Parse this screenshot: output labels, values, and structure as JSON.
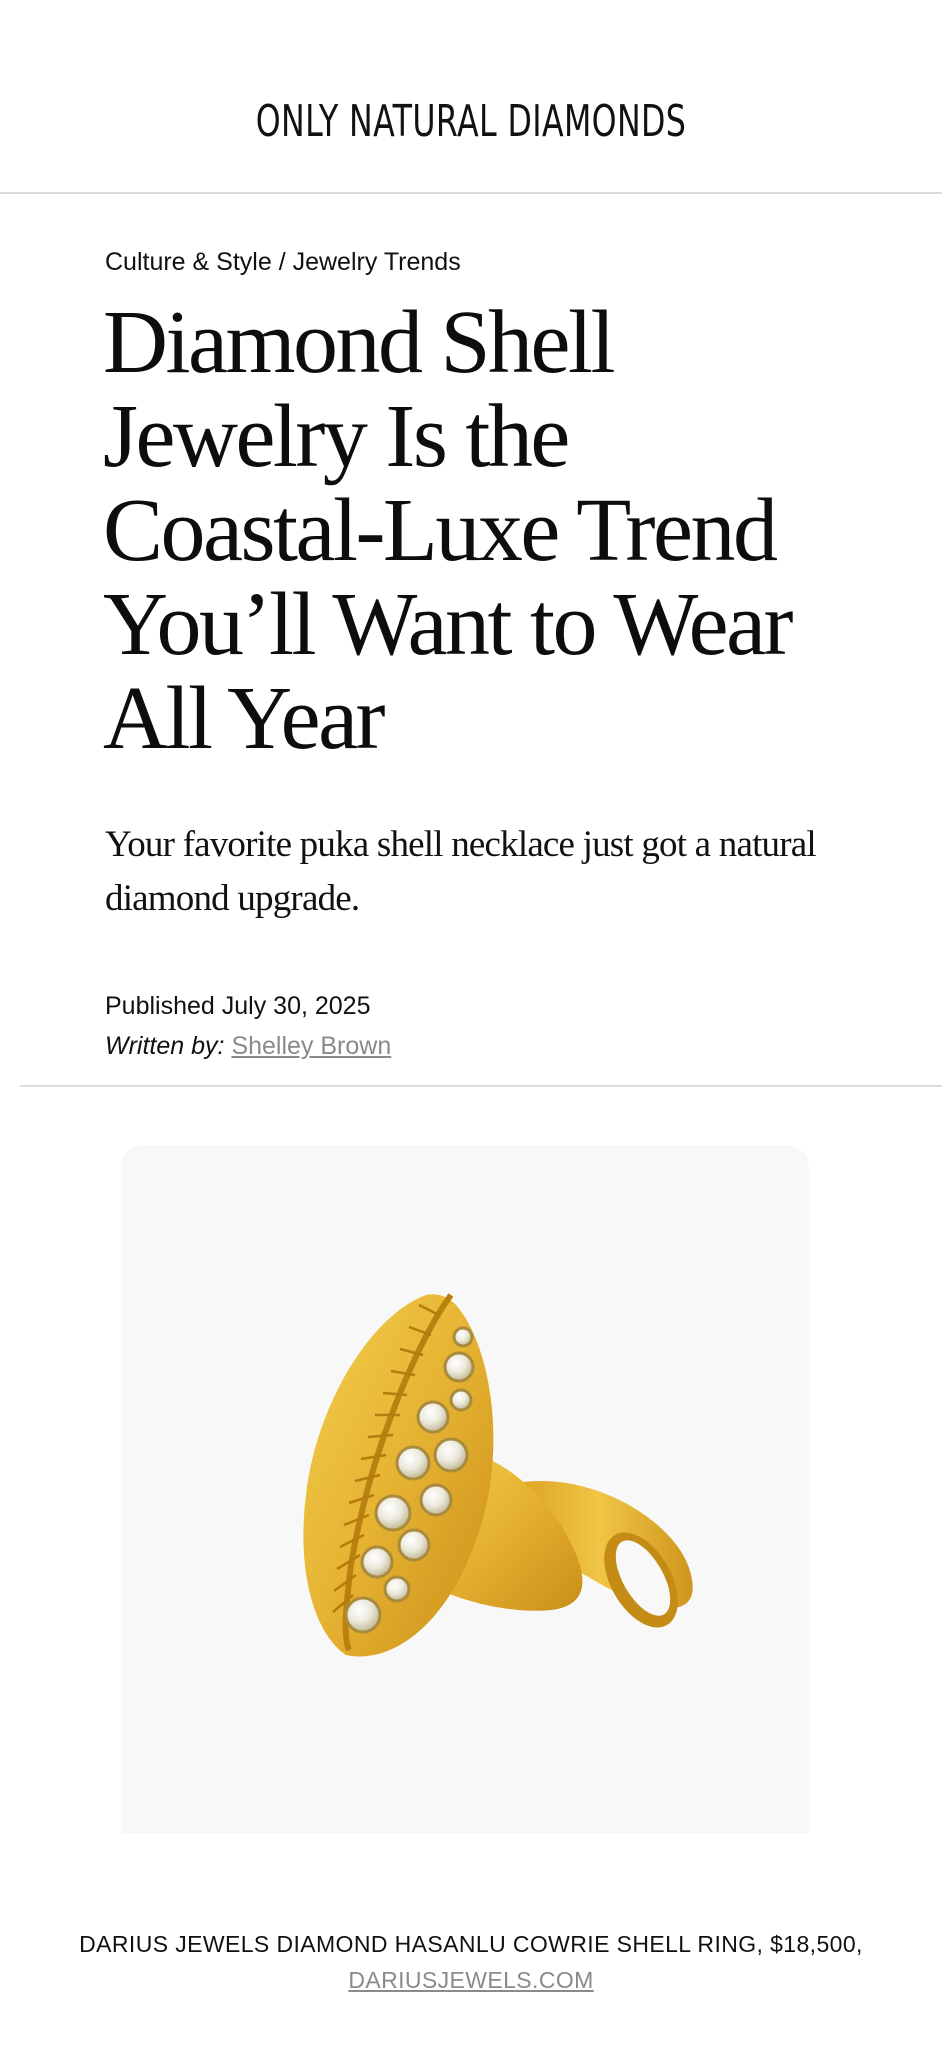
{
  "site": {
    "logo": "ONLY NATURAL DIAMONDS"
  },
  "breadcrumb": {
    "section": "Culture & Style",
    "separator": " / ",
    "category": "Jewelry Trends"
  },
  "article": {
    "title": "Diamond Shell Jewelry Is the Coastal-Luxe Trend You’ll Want to Wear All Year",
    "subtitle": "Your favorite puka shell necklace just got a natural diamond upgrade.",
    "published_label": "Published",
    "published_date": "July 30, 2025",
    "written_by_label": "Written by:",
    "author": "Shelley Brown"
  },
  "hero": {
    "image_alt": "gold-cowrie-shell-ring-with-diamonds",
    "caption_text": "DARIUS JEWELS DIAMOND HASANLU COWRIE SHELL RING, $18,500, ",
    "caption_link": "DARIUSJEWELS.COM"
  },
  "colors": {
    "gold": "#e8b73a",
    "gold_dark": "#c9921c",
    "image_bg": "#f8f8f8",
    "link_gray": "#8a8a8a"
  }
}
